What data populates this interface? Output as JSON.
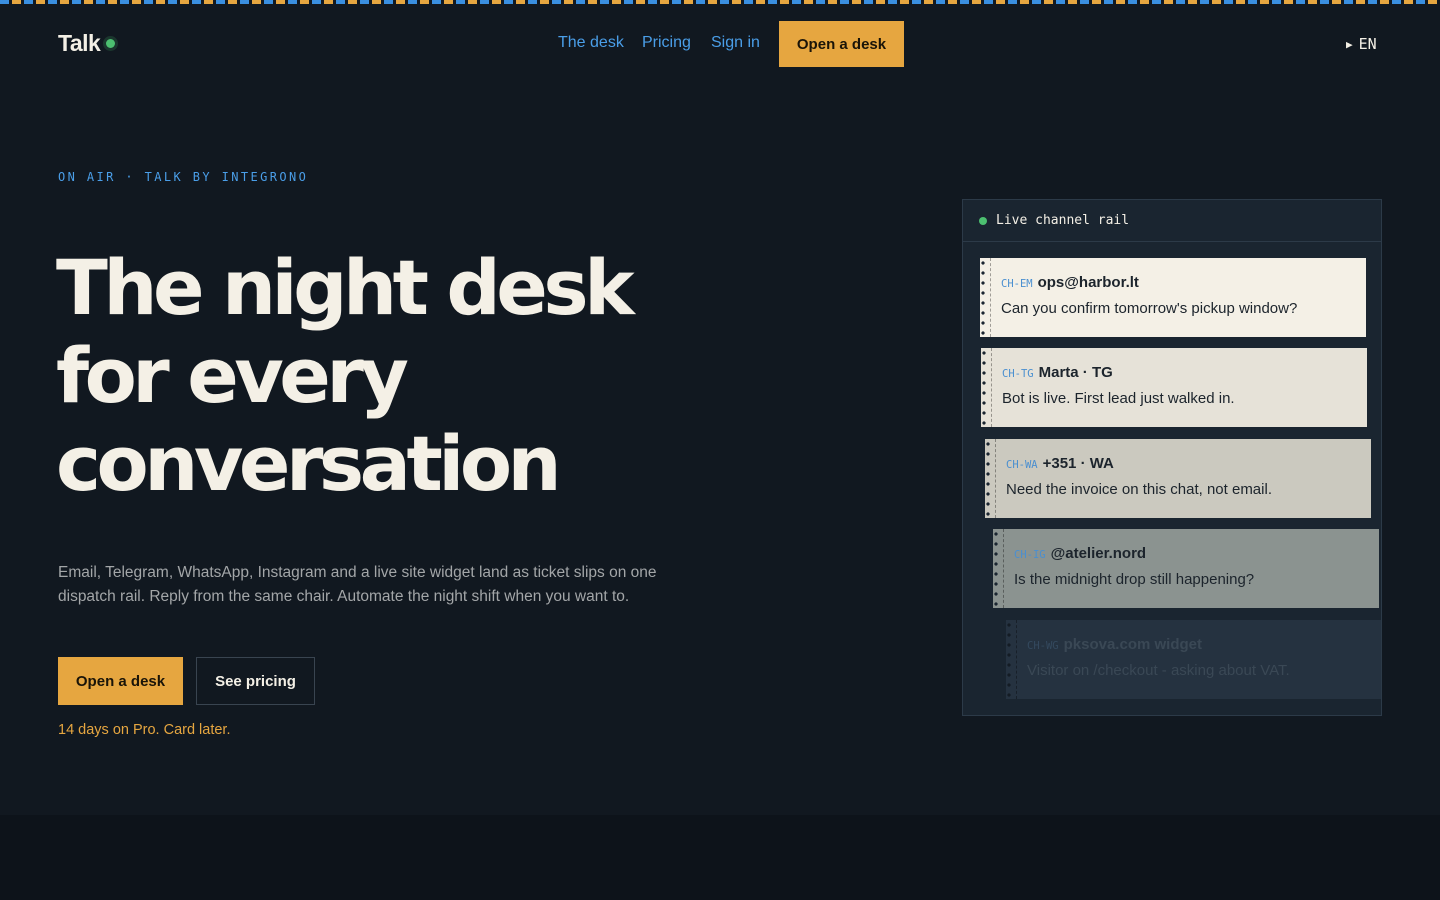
{
  "header": {
    "logo_text": "Talk",
    "nav": [
      "The desk",
      "Pricing",
      "Sign in"
    ],
    "cta_label": "Open a desk",
    "lang_label": "EN"
  },
  "hero": {
    "eyebrow": "ON AIR · TALK BY INTEGRONO",
    "headline_lines": [
      "The night desk",
      "for every",
      "conversation"
    ],
    "lede": "Email, Telegram, WhatsApp, Instagram and a live site widget land as ticket slips on one dispatch rail. Reply from the same chair. Automate the night shift when you want to.",
    "primary_button": "Open a desk",
    "secondary_button": "See pricing",
    "trial_note": "14 days on Pro. Card later."
  },
  "rail": {
    "title": "Live channel rail",
    "slips": [
      {
        "code": "CH-EM",
        "name": "ops@harbor.lt",
        "message": "Can you confirm tomorrow's pickup window?"
      },
      {
        "code": "CH-TG",
        "name": "Marta · TG",
        "message": "Bot is live. First lead just walked in."
      },
      {
        "code": "CH-WA",
        "name": "+351 · WA",
        "message": "Need the invoice on this chat, not email."
      },
      {
        "code": "CH-IG",
        "name": "@atelier.nord",
        "message": "Is the midnight drop still happening?"
      },
      {
        "code": "CH-WG",
        "name": "pksova.com widget",
        "message": "Visitor on /checkout - asking about VAT."
      }
    ]
  },
  "colors": {
    "background": "#111820",
    "accent_amber": "#e6a640",
    "accent_blue": "#4a9ee8",
    "live_green": "#4cc070"
  }
}
